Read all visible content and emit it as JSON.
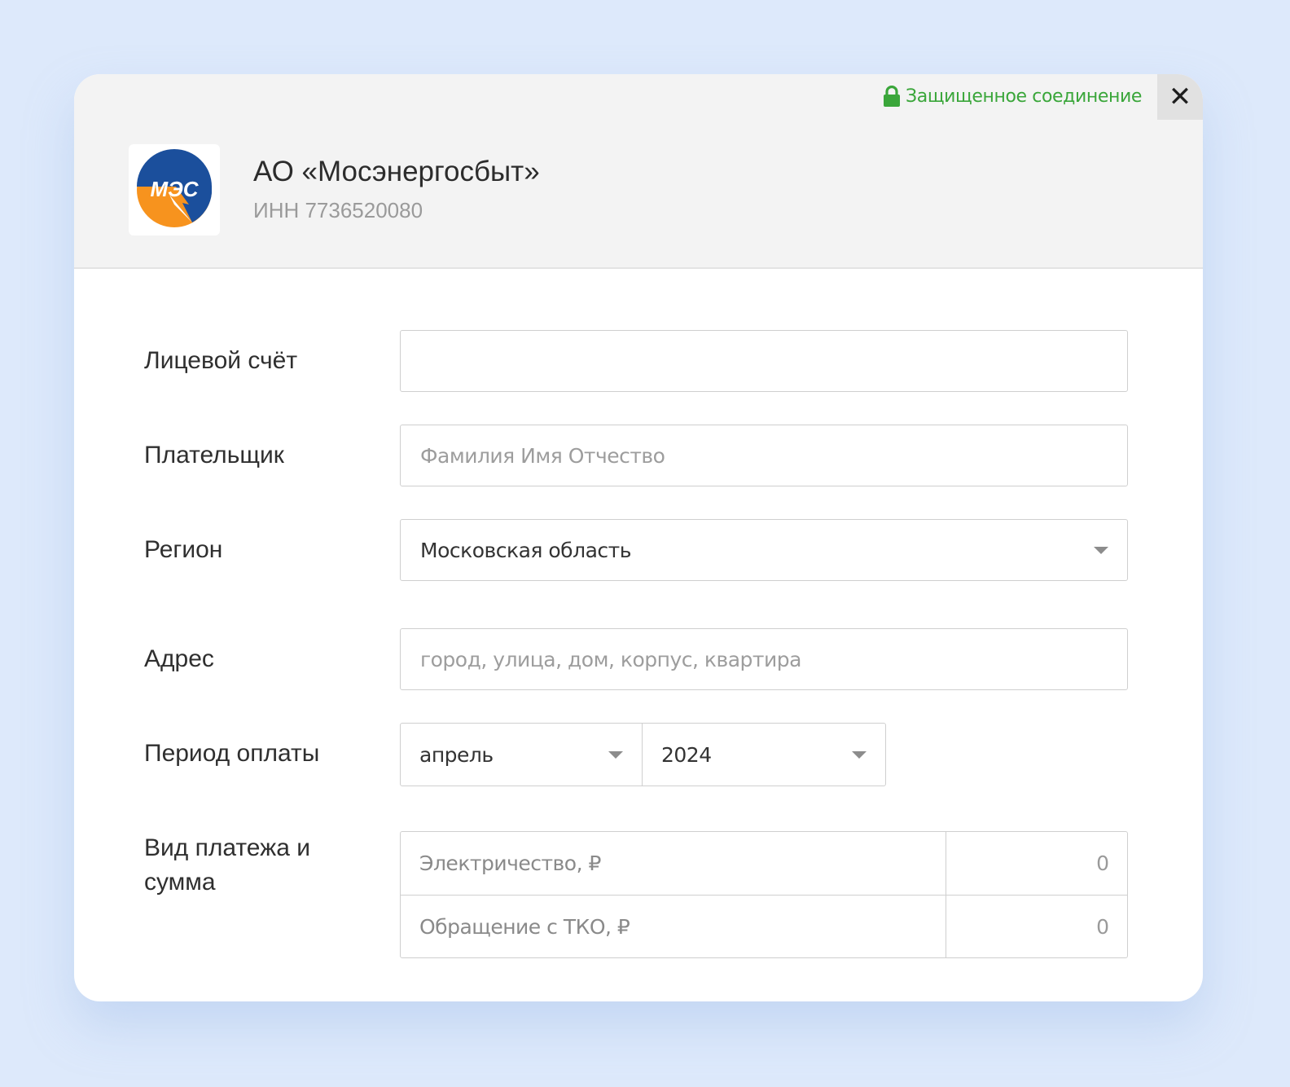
{
  "header": {
    "secure_label": "Защищенное соединение",
    "close_label": "✕",
    "logo_text": "МЭС",
    "company_name": "АО «Мосэнергосбыт»",
    "company_inn": "ИНН 7736520080"
  },
  "form": {
    "account": {
      "label": "Лицевой счёт",
      "value": ""
    },
    "payer": {
      "label": "Плательщик",
      "placeholder": "Фамилия Имя Отчество"
    },
    "region": {
      "label": "Регион",
      "value": "Московская область"
    },
    "address": {
      "label": "Адрес",
      "placeholder": "город, улица, дом, корпус, квартира"
    },
    "period": {
      "label": "Период оплаты",
      "month": "апрель",
      "year": "2024"
    },
    "payment": {
      "label": "Вид платежа и сумма",
      "rows": [
        {
          "name": "Электричество, ₽",
          "amount": "0"
        },
        {
          "name": "Обращение с ТКО, ₽",
          "amount": "0"
        }
      ]
    }
  },
  "colors": {
    "secure_green": "#3aa63a",
    "logo_blue": "#1b4f9c",
    "logo_orange": "#f7931e",
    "background": "#dde9fb"
  }
}
